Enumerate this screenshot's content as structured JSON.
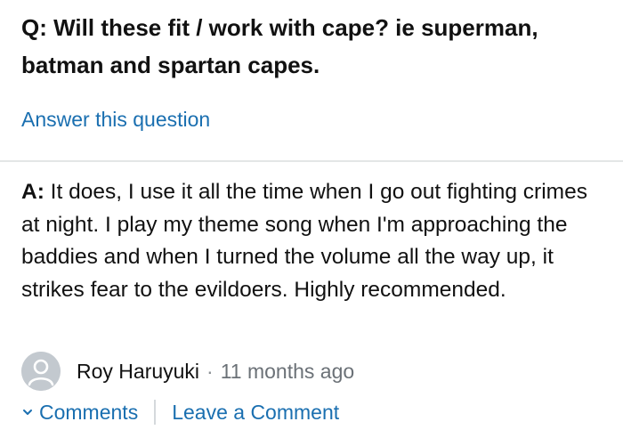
{
  "question": {
    "prefix": "Q:",
    "text": "Will these fit / work with cape? ie superman, batman and spartan capes."
  },
  "answer_this_question_label": "Answer this question",
  "answer": {
    "prefix": "A:",
    "text": "It does, I use it all the time when I go out fighting crimes at night. I play my theme song when I'm approaching the baddies and when I turned the volume all the way up, it strikes fear to the evildoers. Highly recommended."
  },
  "author": {
    "name": "Roy Haruyuki",
    "separator": "·",
    "time": "11 months ago",
    "avatar_icon": "default-user-avatar-icon"
  },
  "actions": {
    "comments_label": "Comments",
    "leave_comment_label": "Leave a Comment",
    "chevron_icon": "chevron-down-icon"
  },
  "colors": {
    "link": "#1a6fb0",
    "text": "#111111",
    "muted": "#6b7177",
    "divider": "#e3e6e6",
    "avatar_bg": "#c3c9cf"
  }
}
